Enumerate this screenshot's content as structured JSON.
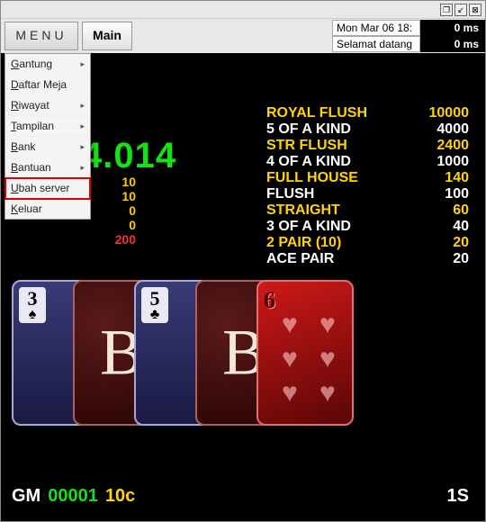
{
  "titlebar": {
    "btn1": "❐",
    "btn2": "↙",
    "btn3": "⊠"
  },
  "topbar": {
    "menu_label": "MENU",
    "main_label": "Main",
    "status": [
      {
        "label": "Mon Mar 06 18:",
        "value": "0 ms"
      },
      {
        "label": "Selamat datang",
        "value": "0 ms"
      }
    ]
  },
  "menu": {
    "items": [
      {
        "label": "Gantung",
        "accel": "G",
        "submenu": true
      },
      {
        "label": "Daftar Meja",
        "accel": "D",
        "submenu": false
      },
      {
        "label": "Riwayat",
        "accel": "R",
        "submenu": true
      },
      {
        "label": "Tampilan",
        "accel": "T",
        "submenu": true
      },
      {
        "label": "Bank",
        "accel": "B",
        "submenu": true
      },
      {
        "label": "Bantuan",
        "accel": "B",
        "submenu": true
      },
      {
        "label": "Ubah server",
        "accel": "U",
        "submenu": false,
        "highlight": true
      },
      {
        "label": "Keluar",
        "accel": "K",
        "submenu": false
      }
    ]
  },
  "big_number": "4.014",
  "side_numbers": [
    "10",
    "10",
    "0",
    "0"
  ],
  "side_red": "200",
  "paytable": [
    {
      "name": "ROYAL FLUSH",
      "pay": "10000",
      "y": true
    },
    {
      "name": "5 OF A KIND",
      "pay": "4000",
      "y": false
    },
    {
      "name": "STR FLUSH",
      "pay": "2400",
      "y": true
    },
    {
      "name": "4 OF A KIND",
      "pay": "1000",
      "y": false
    },
    {
      "name": "FULL HOUSE",
      "pay": "140",
      "y": true
    },
    {
      "name": "FLUSH",
      "pay": "100",
      "y": false
    },
    {
      "name": "STRAIGHT",
      "pay": "60",
      "y": true
    },
    {
      "name": "3 OF A KIND",
      "pay": "40",
      "y": false
    },
    {
      "name": "2 PAIR (10)",
      "pay": "20",
      "y": true
    },
    {
      "name": "ACE PAIR",
      "pay": "20",
      "y": false
    }
  ],
  "cards": [
    {
      "kind": "face",
      "rank": "3",
      "suit": "♠"
    },
    {
      "kind": "back",
      "glyph": "B"
    },
    {
      "kind": "face",
      "rank": "5",
      "suit": "♣"
    },
    {
      "kind": "back",
      "glyph": "B"
    },
    {
      "kind": "six",
      "rank": "6",
      "suit": "♥"
    }
  ],
  "footer": {
    "gm": "GM",
    "id": "00001",
    "bet": "10c",
    "speed": "1S"
  }
}
